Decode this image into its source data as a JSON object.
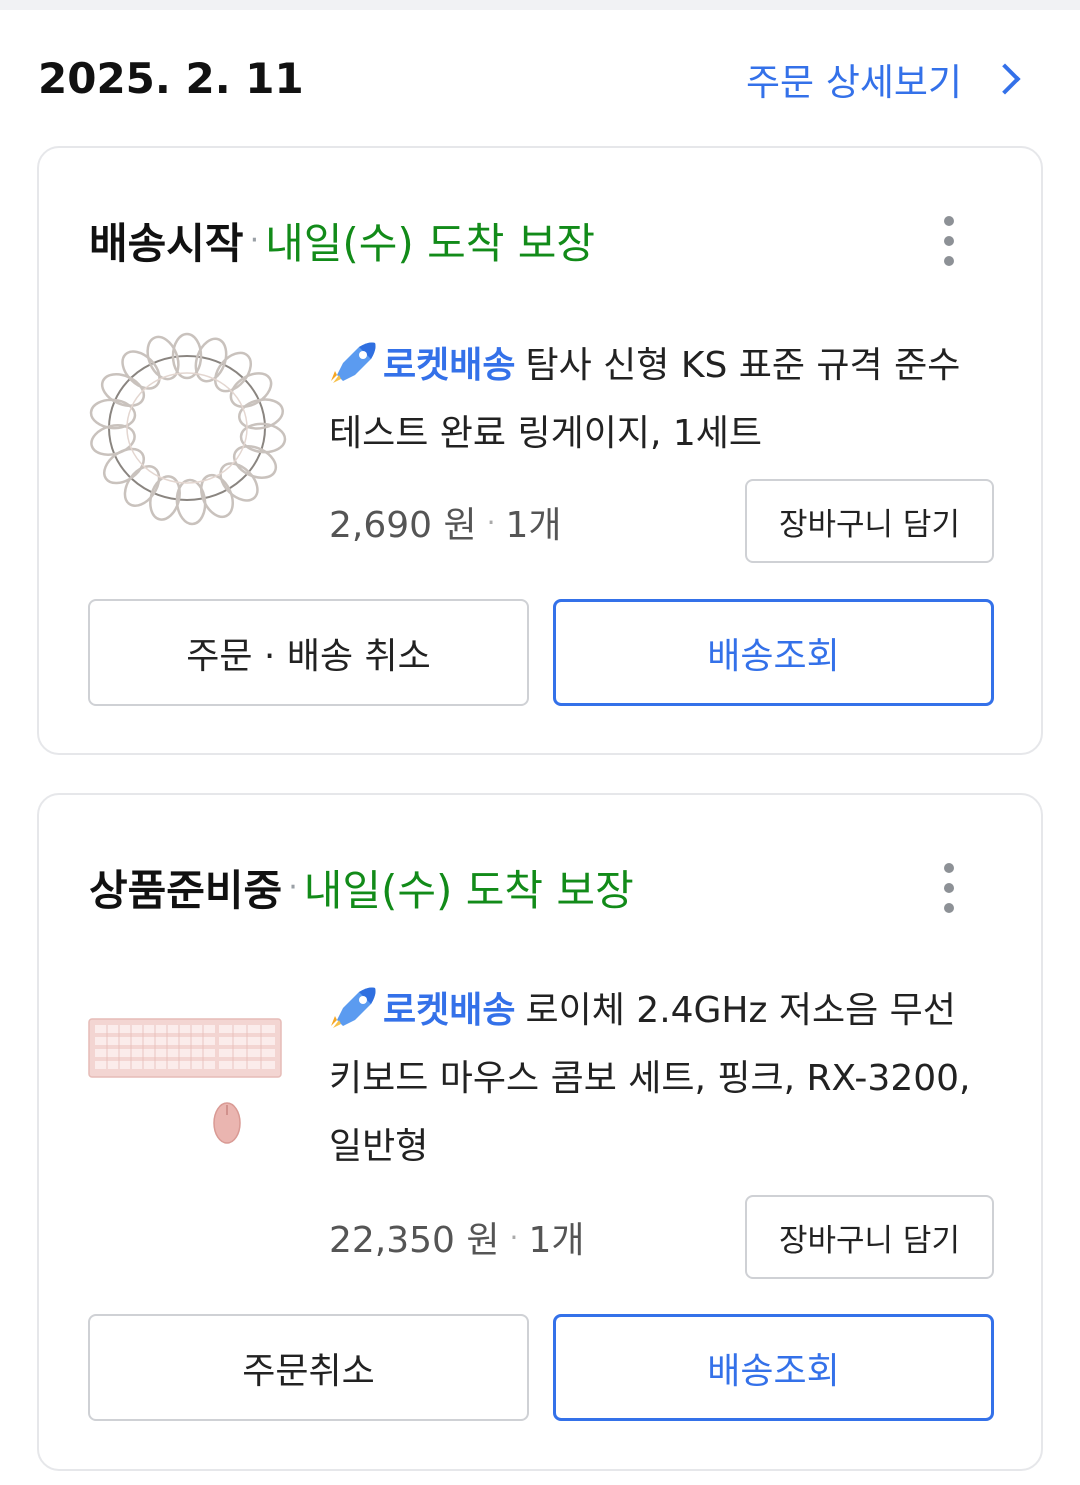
{
  "order": {
    "date": "2025. 2. 11",
    "detail_link_label": "주문 상세보기"
  },
  "items": [
    {
      "status": "배송시작",
      "separator": "·",
      "delivery_promise": "내일(수) 도착 보장",
      "rocket_label": "로켓배송",
      "title": "탐사 신형 KS 표준 규격 준수 테스트 완료 링게이지, 1세트",
      "price": "2,690 원",
      "quantity": "1개",
      "cart_button": "장바구니 담기",
      "cancel_button": "주문 · 배송 취소",
      "track_button": "배송조회",
      "image_icon": "ring-gauge-product-image"
    },
    {
      "status": "상품준비중",
      "separator": "·",
      "delivery_promise": "내일(수) 도착 보장",
      "rocket_label": "로켓배송",
      "title": "로이체 2.4GHz 저소음 무선 키보드 마우스 콤보 세트, 핑크, RX-3200, 일반형",
      "price": "22,350 원",
      "quantity": "1개",
      "cart_button": "장바구니 담기",
      "cancel_button": "주문취소",
      "track_button": "배송조회",
      "image_icon": "pink-keyboard-mouse-product-image"
    }
  ],
  "colors": {
    "accent_blue": "#3471e9",
    "promise_green": "#128b19",
    "text_dark": "#111111",
    "border_gray": "#cfd1d5"
  }
}
